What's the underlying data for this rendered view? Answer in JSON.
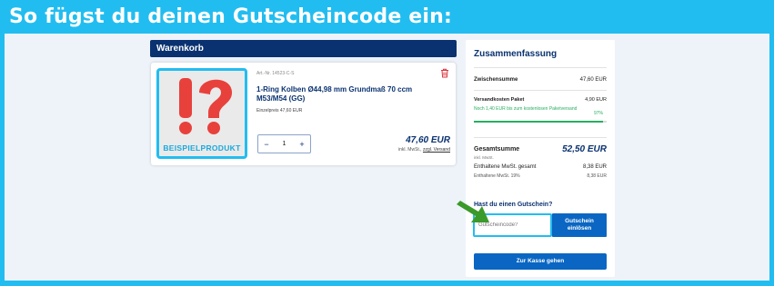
{
  "banner": {
    "title": "So fügst du deinen Gutscheincode ein:"
  },
  "cart": {
    "header": "Warenkorb",
    "item": {
      "image_label": "BEISPIELPRODUKT",
      "article_no": "Art.-Nr. 14523-C-S",
      "name": "1-Ring Kolben Ø44,98 mm Grundmaß 70 ccm M53/M54 (GG)",
      "unit_price": "Einzelpreis 47,60 EUR",
      "quantity": "1",
      "minus": "−",
      "plus": "+",
      "line_total": "47,60 EUR",
      "tax_prefix": "inkl. MwSt.,",
      "shipping_link": "zzgl. Versand"
    }
  },
  "summary": {
    "title": "Zusammenfassung",
    "subtotal_label": "Zwischensumme",
    "subtotal_value": "47,60 EUR",
    "shipping_label": "Versandkosten Paket",
    "shipping_value": "4,90 EUR",
    "free_ship_text": "Noch 1,40 EUR bis zum kostenlosen Paketversand",
    "free_ship_percent": "97%",
    "free_ship_progress": 0.97,
    "total_label": "Gesamtsumme",
    "total_value": "52,50 EUR",
    "total_sub": "inkl. MwSt.",
    "vat_total_label": "Enthaltene MwSt. gesamt",
    "vat_total_value": "8,38 EUR",
    "vat_19_label": "Enthaltene MwSt. 19%",
    "vat_19_value": "8,38 EUR",
    "coupon_title": "Hast du einen Gutschein?",
    "coupon_placeholder": "Gutscheincode?",
    "coupon_button": "Gutschein\neinlösen",
    "checkout_button": "Zur Kasse gehen"
  },
  "colors": {
    "brand_navy": "#0a3270",
    "accent_cyan": "#22bdf0",
    "button_blue": "#0a66c2",
    "success_green": "#27ae60",
    "placeholder_red": "#e8413c",
    "arrow_green": "#3a9a2a"
  },
  "icons": {
    "delete": "trash-icon",
    "placeholder_mark": "question-exclamation-icon",
    "pointer": "arrow-icon"
  }
}
